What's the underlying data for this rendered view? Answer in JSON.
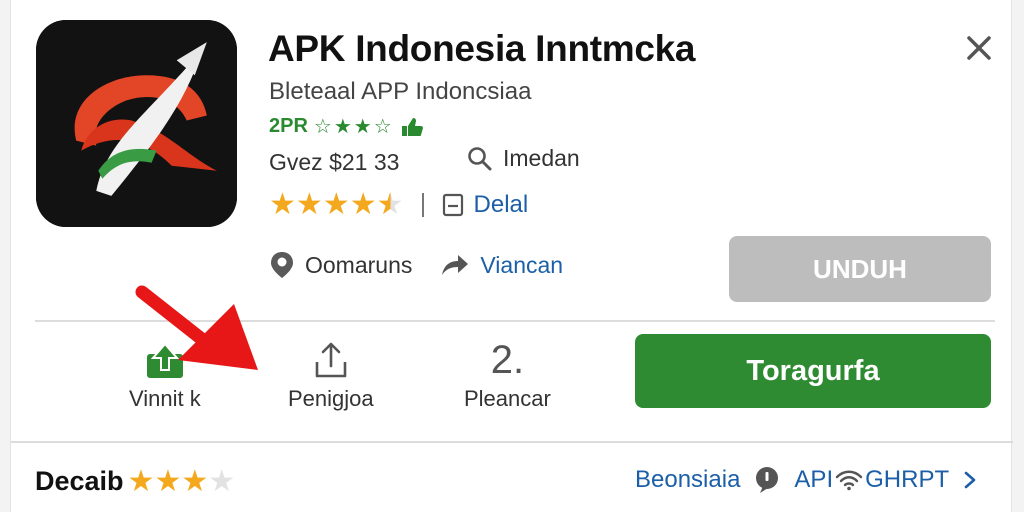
{
  "app": {
    "title": "APK Indonesia Inntmcka",
    "subtitle": "Bleteaal APP Indoncsiaa",
    "green_rating_text": "2PR",
    "green_rating_stars": 4,
    "size_text": "Gvez $21 33",
    "location_text": "Imedan",
    "rating_value": 4.5,
    "detail_link": "Delal",
    "compare_label": "Oomaruns",
    "share_label": "Viancan",
    "download_button": "UNDUH"
  },
  "actions": [
    {
      "label": "Vinnit k",
      "icon": "upload-box-icon"
    },
    {
      "label": "Penigjoa",
      "icon": "share-up-icon"
    },
    {
      "label": "Pleancar",
      "icon_text": "2."
    }
  ],
  "primary_button": "Toragurfa",
  "bottom": {
    "left_label": "Decaib",
    "left_stars": 3,
    "right_link": "Beonsiaia",
    "right_api": "API",
    "right_tail": "GHRPT"
  },
  "colors": {
    "accent_green": "#2e8b31",
    "link_blue": "#1c5fa8",
    "star_gold": "#f4a81d",
    "disabled_gray": "#bdbdbd",
    "annotation_red": "#e81717"
  }
}
